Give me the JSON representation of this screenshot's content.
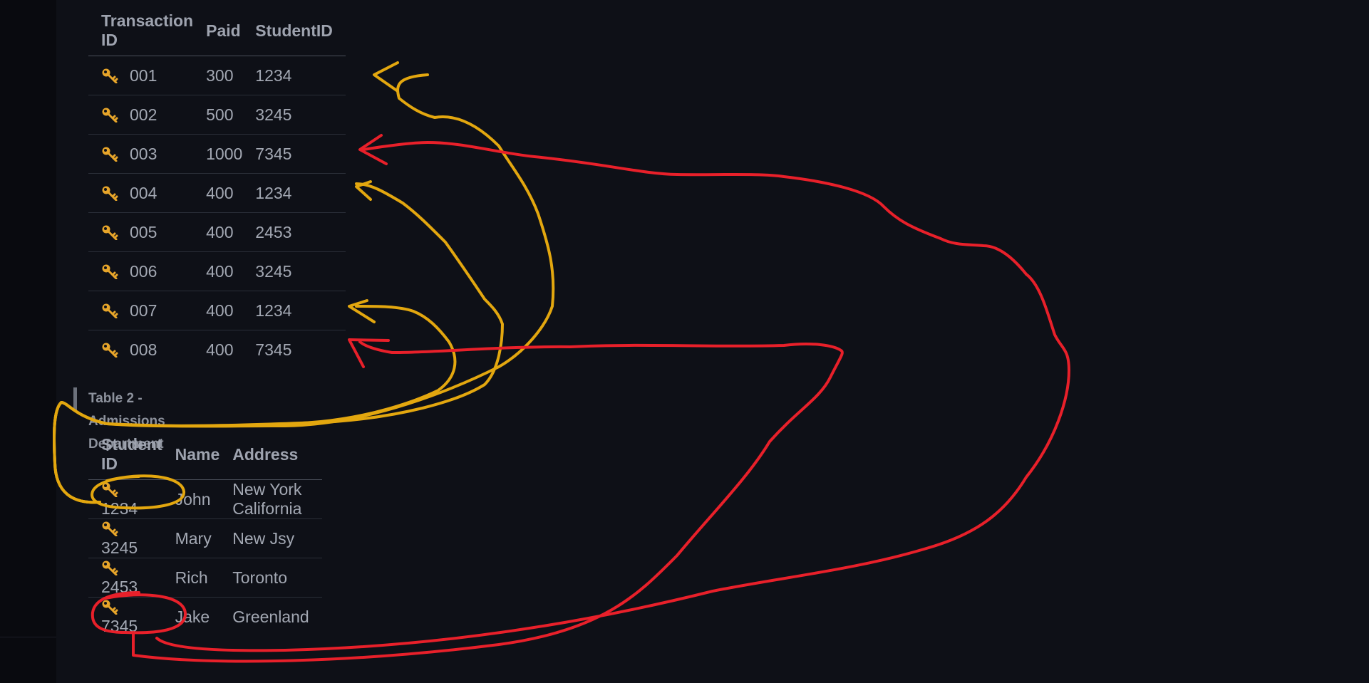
{
  "table1": {
    "headers": [
      "Transaction ID",
      "Paid",
      "StudentID"
    ],
    "rows": [
      [
        "001",
        "300",
        "1234"
      ],
      [
        "002",
        "500",
        "3245"
      ],
      [
        "003",
        "1000",
        "7345"
      ],
      [
        "004",
        "400",
        "1234"
      ],
      [
        "005",
        "400",
        "2453"
      ],
      [
        "006",
        "400",
        "3245"
      ],
      [
        "007",
        "400",
        "1234"
      ],
      [
        "008",
        "400",
        "7345"
      ]
    ]
  },
  "caption": "Table 2 - Admissions Department",
  "table2": {
    "headers": [
      "Student ID",
      "Name",
      "Address"
    ],
    "rows": [
      [
        "1234",
        "John",
        "New York California"
      ],
      [
        "3245",
        "Mary",
        "New Jsy"
      ],
      [
        "2453",
        "Rich",
        "Toronto"
      ],
      [
        "7345",
        "Jake",
        "Greenland"
      ]
    ]
  },
  "colors": {
    "background": "#0e1017",
    "key_icon": "#e7a52a",
    "annotation_yellow": "#e3a70f",
    "annotation_red": "#e8202a"
  },
  "icons": {
    "row_key": "key-icon"
  }
}
